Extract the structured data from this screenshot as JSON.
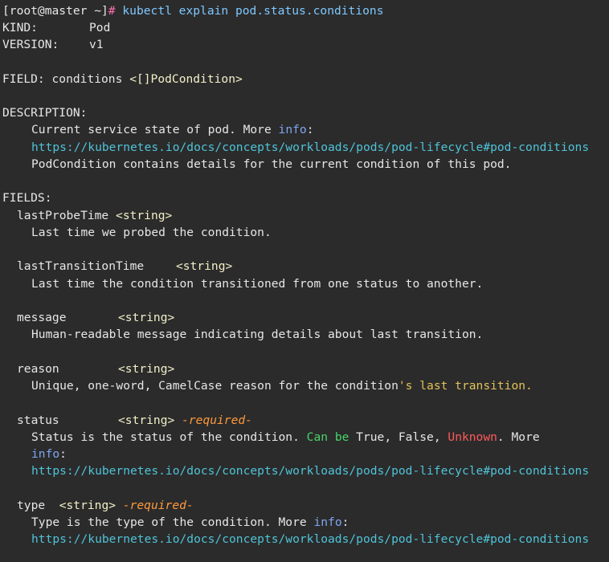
{
  "terminal": {
    "prompt": "[root@master ~]",
    "prompt_symbol": "#",
    "command_space": " ",
    "command": "kubectl explain pod.status.conditions",
    "kind_label": "KIND:",
    "kind_value": "Pod",
    "version_label": "VERSION:",
    "version_value": "v1",
    "field_label": "FIELD:",
    "field_name": "conditions",
    "field_type": "<[]PodCondition>",
    "description_label": "DESCRIPTION:",
    "description_line1": "Current service state of pod. More",
    "info_word": "info",
    "url_pod_conditions": "https://kubernetes.io/docs/concepts/workloads/pods/pod-lifecycle#pod-conditions",
    "description_line3": "PodCondition contains details for the current condition of this pod.",
    "fields_label": "FIELDS:",
    "fields": {
      "lastProbeTime": {
        "name": "lastProbeTime",
        "type": "<string>",
        "desc": "Last time we probed the condition."
      },
      "lastTransitionTime": {
        "name": "lastTransitionTime",
        "type": "<string>",
        "desc": "Last time the condition transitioned from one status to another."
      },
      "message": {
        "name": "message",
        "type": "<string>",
        "desc": "Human-readable message indicating details about last transition."
      },
      "reason": {
        "name": "reason",
        "type": "<string>",
        "desc_main": "Unique, one-word, CamelCase reason for the condition",
        "desc_tail": "'s last transition."
      },
      "status": {
        "name": "status",
        "type": "<string>",
        "required": "-required-",
        "desc_a": "Status is the status of the condition. ",
        "can_be": "Can be",
        "values_text": " True, False, ",
        "unknown": "Unknown",
        "more": ". More"
      },
      "type": {
        "name": "type",
        "type": "<string>",
        "required": "-required-",
        "desc": "Type is the type of the condition. More"
      }
    },
    "colors": {
      "background": "#2b2b2b",
      "text": "#e6e6e6",
      "link": "#4fc3d8",
      "required": "#ff9a3c",
      "green": "#49d36b",
      "red": "#ff5a5a"
    }
  }
}
